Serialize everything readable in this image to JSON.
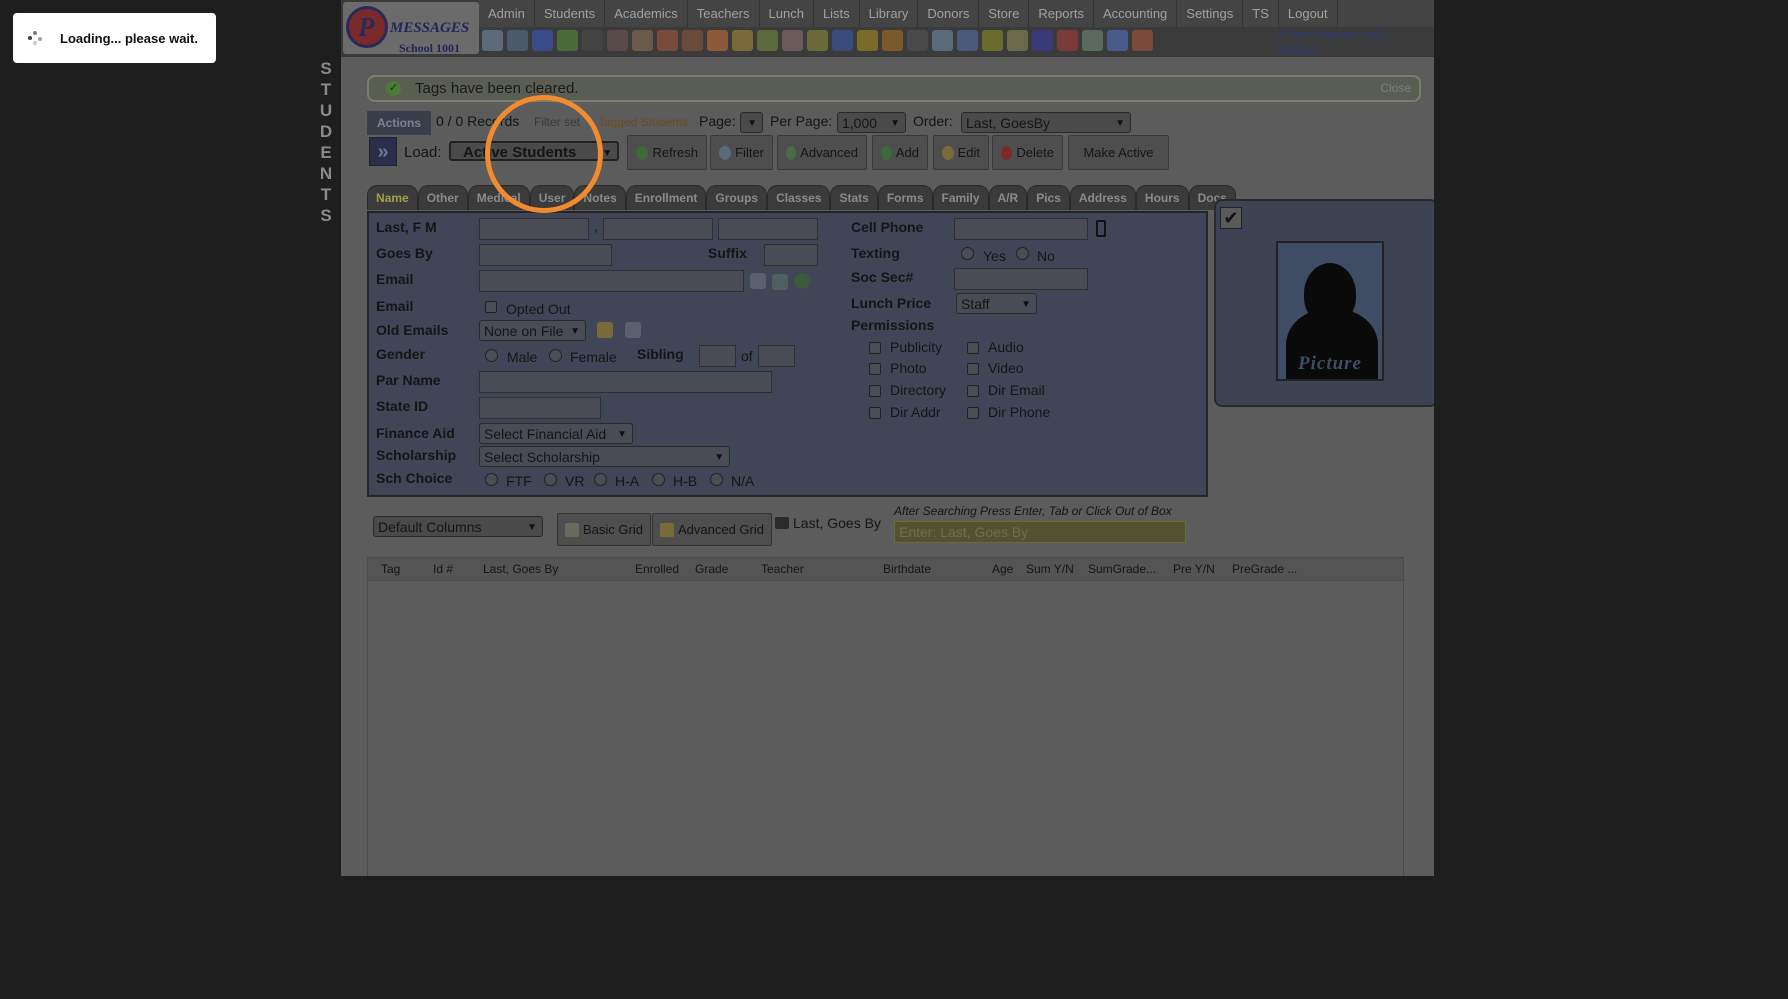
{
  "loading": {
    "text": "Loading... please wait."
  },
  "side_word": [
    "S",
    "T",
    "U",
    "D",
    "E",
    "N",
    "T",
    "S"
  ],
  "logo": {
    "letter": "P",
    "word": "MESSAGES",
    "school": "School 1001"
  },
  "nav": [
    "Admin",
    "Students",
    "Academics",
    "Teachers",
    "Lunch",
    "Lists",
    "Library",
    "Donors",
    "Store",
    "Reports",
    "Accounting",
    "Settings",
    "TS",
    "Logout"
  ],
  "toolbar_icons": [
    "search-icon",
    "calculator-icon",
    "email-at-icon",
    "chat-icon",
    "mobile-icon",
    "speaker-icon",
    "grid-icon",
    "calendar-icon",
    "megaphone-icon",
    "person-orange-icon",
    "person-yellow-icon",
    "tag-icon",
    "people-icon",
    "card-icon",
    "book-icon",
    "broom-icon",
    "gift-icon",
    "user-tie-icon",
    "clock-icon",
    "table-icon",
    "ticket-icon",
    "register-icon",
    "ap-icon",
    "pdf-icon",
    "money-icon",
    "help-icon",
    "power-icon"
  ],
  "icon_colors": [
    "#5a6a7a",
    "#4a5a6a",
    "#3a4a8a",
    "#4a6a3a",
    "#444",
    "#5a4a4a",
    "#6a5a4a",
    "#7a4a3a",
    "#6a4a3a",
    "#8a5a3a",
    "#7a6a3a",
    "#5a6a3a",
    "#6a5a5a",
    "#6a6a3a",
    "#3a4a7a",
    "#7a6a2a",
    "#7a5a2a",
    "#4a4a4a",
    "#5a6a7a",
    "#4a5a7a",
    "#6a6a2a",
    "#6a6a4a",
    "#3a3a7a",
    "#7a3a3a",
    "#5a6a5a",
    "#4a5a8a",
    "#7a4a3a"
  ],
  "user": {
    "name": "2-Tech Support-2 (s5)",
    "clock": "Clock In"
  },
  "message": {
    "text": "Tags have been cleared.",
    "close": "Close"
  },
  "row1": {
    "actions": "Actions",
    "records": "0 / 0 Records",
    "filter_set": "Filter set",
    "tagged": "Tagged Students",
    "page_label": "Page:",
    "page_value": "",
    "per_page_label": "Per Page:",
    "per_page_value": "1,000",
    "order_label": "Order:",
    "order_value": "Last, GoesBy"
  },
  "row2": {
    "load_label": "Load:",
    "load_value": "Active Students",
    "buttons": [
      {
        "label": "Refresh",
        "icon": "refresh-icon",
        "color": "#3e6a3a"
      },
      {
        "label": "Filter",
        "icon": "magnifier-icon",
        "color": "#5a6a7a"
      },
      {
        "label": "Advanced",
        "icon": "advanced-icon",
        "color": "#4a6a4a"
      },
      {
        "label": "Add",
        "icon": "add-icon",
        "color": "#3e6a3a"
      },
      {
        "label": "Edit",
        "icon": "pencil-icon",
        "color": "#7a6a3a"
      },
      {
        "label": "Delete",
        "icon": "delete-icon",
        "color": "#7a2a2a"
      },
      {
        "label": "Make Active",
        "icon": "",
        "color": ""
      }
    ]
  },
  "tabs": [
    "Name",
    "Other",
    "Medical",
    "User",
    "Notes",
    "Enrollment",
    "Groups",
    "Classes",
    "Stats",
    "Forms",
    "Family",
    "A/R",
    "Pics",
    "Address",
    "Hours",
    "Docs"
  ],
  "form": {
    "last_fm": "Last, F M",
    "comma": ",",
    "goes_by": "Goes By",
    "suffix": "Suffix",
    "email": "Email",
    "email2": "Email",
    "opted_out": "Opted Out",
    "old_emails": "Old Emails",
    "old_emails_value": "None on File",
    "gender": "Gender",
    "male": "Male",
    "female": "Female",
    "sibling": "Sibling",
    "of": "of",
    "par_name": "Par Name",
    "state_id": "State ID",
    "finance_aid": "Finance Aid",
    "finance_aid_value": "Select Financial Aid",
    "scholarship": "Scholarship",
    "scholarship_value": "Select Scholarship",
    "sch_choice": "Sch Choice",
    "sch_options": [
      "FTF",
      "VR",
      "H-A",
      "H-B",
      "N/A"
    ],
    "cell_phone": "Cell Phone",
    "texting": "Texting",
    "yes": "Yes",
    "no": "No",
    "soc_sec": "Soc Sec#",
    "lunch_price": "Lunch Price",
    "lunch_price_value": "Staff",
    "permissions": "Permissions",
    "perm_left": [
      "Publicity",
      "Photo",
      "Directory",
      "Dir Addr"
    ],
    "perm_right": [
      "Audio",
      "Video",
      "Dir Email",
      "Dir Phone"
    ]
  },
  "picture": {
    "caption": "Picture"
  },
  "gridbar": {
    "columns_value": "Default Columns",
    "basic_grid": "Basic Grid",
    "advanced_grid": "Advanced Grid",
    "search_label": "Last, Goes By",
    "hint": "After Searching Press Enter, Tab or Click Out of Box",
    "search_placeholder": "Enter: Last, Goes By"
  },
  "grid_headers": [
    "Tag",
    "Id #",
    "Last, Goes By",
    "Enrolled",
    "Grade",
    "Teacher",
    "Birthdate",
    "Age",
    "Sum Y/N",
    "SumGrade...",
    "Pre Y/N",
    "PreGrade ..."
  ]
}
